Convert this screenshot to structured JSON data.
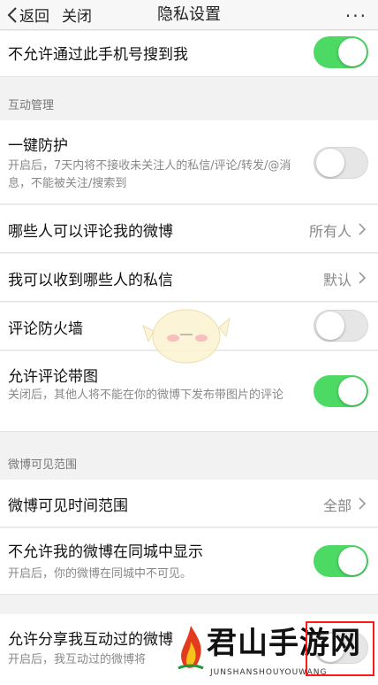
{
  "nav": {
    "back_label": "返回",
    "close_label": "关闭",
    "title": "隐私设置",
    "more_label": "···"
  },
  "rows": {
    "search_by_phone": {
      "title": "不允许通过此手机号搜到我",
      "toggle": "on"
    },
    "section_interaction": "互动管理",
    "one_key_protect": {
      "title": "一键防护",
      "desc": "开启后，7天内将不接收未关注人的私信/评论/转发/@消息，不能被关注/搜索到",
      "toggle": "off"
    },
    "who_can_comment": {
      "title": "哪些人可以评论我的微博",
      "value": "所有人"
    },
    "who_can_message": {
      "title": "我可以收到哪些人的私信",
      "value": "默认"
    },
    "comment_firewall": {
      "title": "评论防火墙",
      "toggle": "off"
    },
    "allow_comment_images": {
      "title": "允许评论带图",
      "desc": "关闭后，其他人将不能在你的微博下发布带图片的评论",
      "toggle": "on"
    },
    "section_visibility": "微博可见范围",
    "visible_time_range": {
      "title": "微博可见时间范围",
      "value": "全部"
    },
    "hide_in_city": {
      "title": "不允许我的微博在同城中显示",
      "desc": "开启后，你的微博在同城中不可见。",
      "toggle": "on"
    },
    "share_interacted": {
      "title": "允许分享我互动过的微博",
      "desc": "开启后，我互动过的微博将",
      "toggle": "off"
    }
  },
  "watermark": {
    "text": "君山手游网",
    "sub": "JUNSHANSHOUYOUWANG"
  },
  "colors": {
    "toggle_on": "#4cd964",
    "toggle_off": "#e6e6e6",
    "highlight_box": "#ff1a1a"
  }
}
